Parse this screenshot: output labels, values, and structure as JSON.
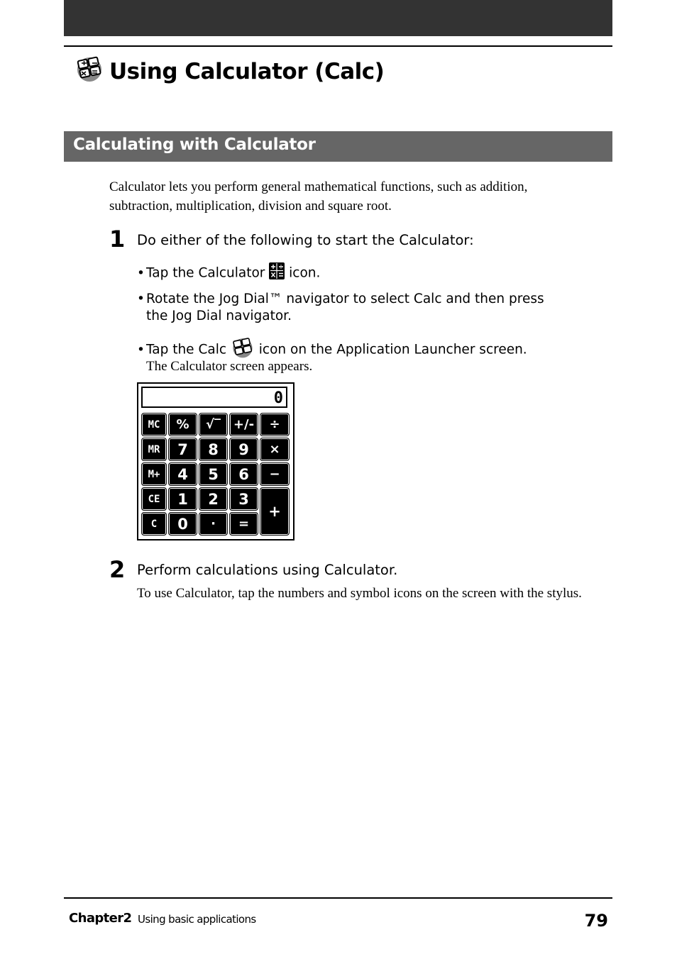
{
  "page": {
    "title": "Using Calculator (Calc)",
    "section_title": "Calculating with Calculator",
    "intro": "Calculator lets you perform general mathematical functions, such as addition, subtraction, multiplication, division and square root."
  },
  "steps": [
    {
      "number": "1",
      "heading": "Do either of the following to start the Calculator:",
      "bullets": [
        {
          "before": "Tap the Calculator",
          "icon": "calculator-button-icon",
          "after": "icon."
        },
        {
          "before": "Rotate the Jog Dial™ navigator to select Calc and then press",
          "cont": "the Jog Dial navigator."
        },
        {
          "before": "Tap the Calc",
          "icon": "calc-app-icon",
          "after": "icon on the Application Launcher screen."
        }
      ],
      "result": "The Calculator screen appears."
    },
    {
      "number": "2",
      "heading": "Perform calculations using Calculator.",
      "body": "To use Calculator, tap the numbers and symbol icons on the screen with the stylus."
    }
  ],
  "calculator": {
    "display": "0",
    "keys": [
      {
        "label": "MC",
        "kind": "small"
      },
      {
        "label": "%",
        "kind": "op"
      },
      {
        "label": "√‾",
        "kind": "op"
      },
      {
        "label": "+/-",
        "kind": "op"
      },
      {
        "label": "÷",
        "kind": "op"
      },
      {
        "label": "MR",
        "kind": "small"
      },
      {
        "label": "7"
      },
      {
        "label": "8"
      },
      {
        "label": "9"
      },
      {
        "label": "×",
        "kind": "op"
      },
      {
        "label": "M+",
        "kind": "small"
      },
      {
        "label": "4"
      },
      {
        "label": "5"
      },
      {
        "label": "6"
      },
      {
        "label": "−",
        "kind": "op"
      },
      {
        "label": "CE",
        "kind": "small"
      },
      {
        "label": "1"
      },
      {
        "label": "2"
      },
      {
        "label": "3"
      },
      {
        "label": "+",
        "kind": "plus"
      },
      {
        "label": "C",
        "kind": "small"
      },
      {
        "label": "0"
      },
      {
        "label": "·",
        "kind": "op"
      },
      {
        "label": "=",
        "kind": "op"
      }
    ]
  },
  "footer": {
    "chapter": "Chapter2",
    "description": "Using basic applications",
    "page_number": "79"
  }
}
